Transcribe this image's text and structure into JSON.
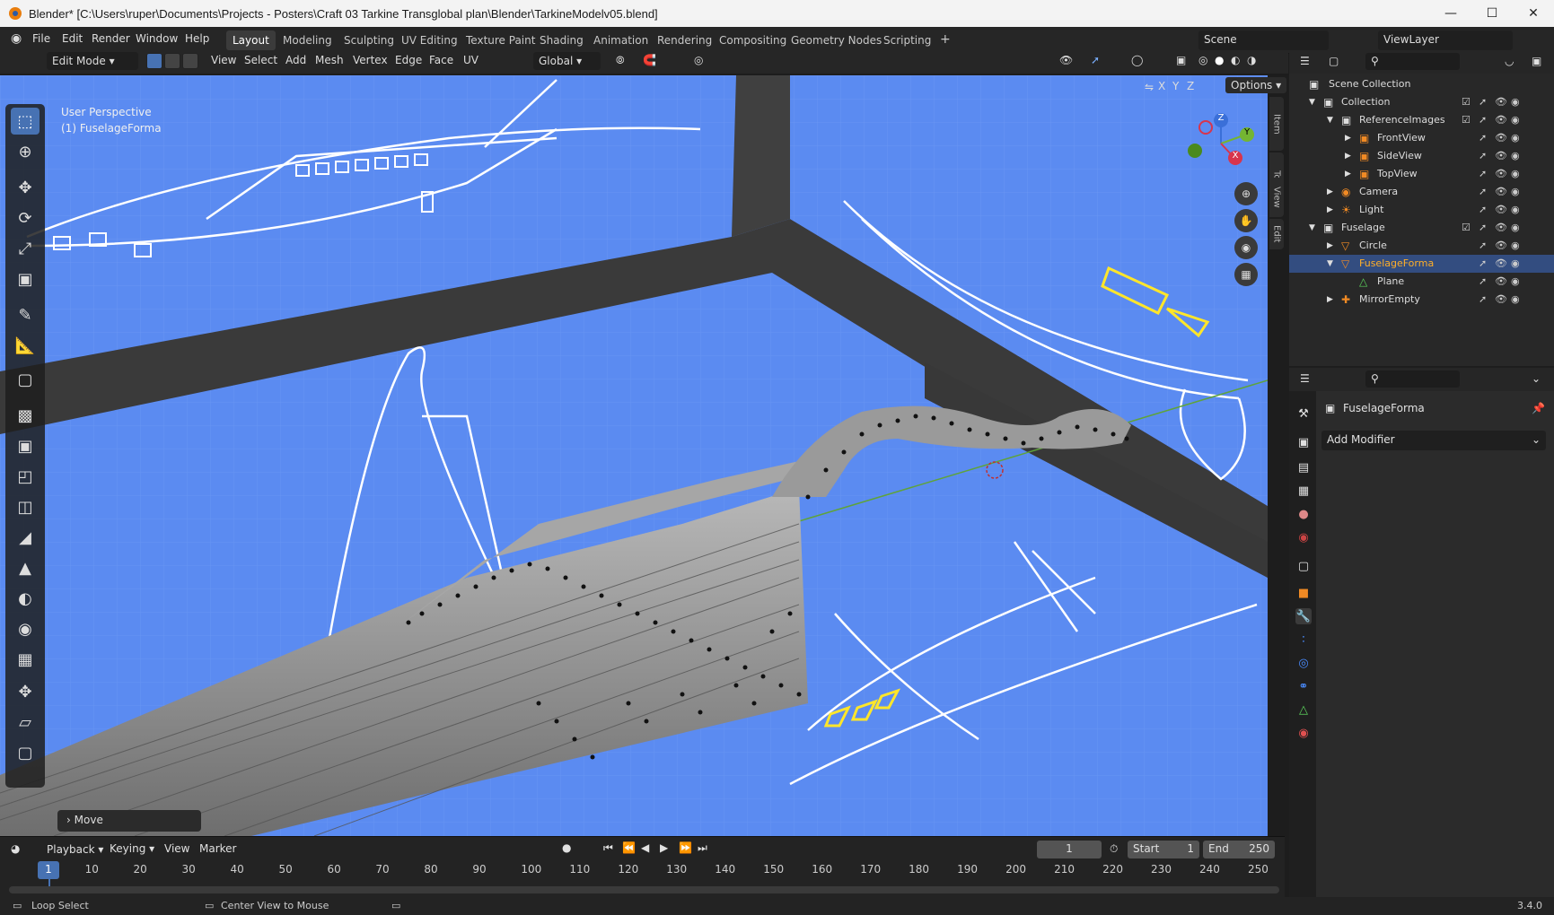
{
  "window": {
    "title": "Blender* [C:\\Users\\ruper\\Documents\\Projects - Posters\\Craft 03 Tarkine Transglobal plan\\Blender\\TarkineModelv05.blend]"
  },
  "menus": [
    "File",
    "Edit",
    "Render",
    "Window",
    "Help"
  ],
  "workspaces": [
    "Layout",
    "Modeling",
    "Sculpting",
    "UV Editing",
    "Texture Paint",
    "Shading",
    "Animation",
    "Rendering",
    "Compositing",
    "Geometry Nodes",
    "Scripting"
  ],
  "scene": {
    "label": "Scene",
    "view_layer": "ViewLayer"
  },
  "viewport_header": {
    "mode": "Edit Mode",
    "items": [
      "View",
      "Select",
      "Add",
      "Mesh",
      "Vertex",
      "Edge",
      "Face",
      "UV"
    ],
    "orientation": "Global",
    "options": "Options",
    "axes": [
      "X",
      "Y",
      "Z"
    ]
  },
  "viewport": {
    "perspective": "User Perspective",
    "object": "(1) FuselageForma",
    "last_op": "Move"
  },
  "side_tabs": [
    "Item",
    "Tool",
    "View",
    "Edit"
  ],
  "gizmo": {
    "z": "Z",
    "y": "Y",
    "x": "X"
  },
  "outliner": {
    "root": "Scene Collection",
    "rows": [
      {
        "label": "Collection",
        "indent": 1
      },
      {
        "label": "ReferenceImages",
        "indent": 2
      },
      {
        "label": "FrontView",
        "indent": 3
      },
      {
        "label": "SideView",
        "indent": 3
      },
      {
        "label": "TopView",
        "indent": 3
      },
      {
        "label": "Camera",
        "indent": 2
      },
      {
        "label": "Light",
        "indent": 2
      },
      {
        "label": "Fuselage",
        "indent": 1
      },
      {
        "label": "Circle",
        "indent": 2
      },
      {
        "label": "FuselageForma",
        "indent": 2
      },
      {
        "label": "Plane",
        "indent": 3
      },
      {
        "label": "MirrorEmpty",
        "indent": 2
      }
    ]
  },
  "properties": {
    "object": "FuselageForma",
    "add_modifier": "Add Modifier"
  },
  "timeline": {
    "menus": [
      "Playback",
      "Keying",
      "View",
      "Marker"
    ],
    "current_frame": "1",
    "start_label": "Start",
    "start": "1",
    "end_label": "End",
    "end": "250",
    "ticks": [
      "1",
      "10",
      "20",
      "30",
      "40",
      "50",
      "60",
      "70",
      "80",
      "90",
      "100",
      "110",
      "120",
      "130",
      "140",
      "150",
      "160",
      "170",
      "180",
      "190",
      "200",
      "210",
      "220",
      "230",
      "240",
      "250"
    ]
  },
  "statusbar": {
    "left": "Loop Select",
    "middle": "Center View to Mouse",
    "version": "3.4.0"
  },
  "colors": {
    "viewport_bg": "#5b8bf1",
    "accent": "#4772b3",
    "selected_text": "#ffaf29",
    "blueprint_line": "#ffffff",
    "wall": "#3a3a3a"
  }
}
